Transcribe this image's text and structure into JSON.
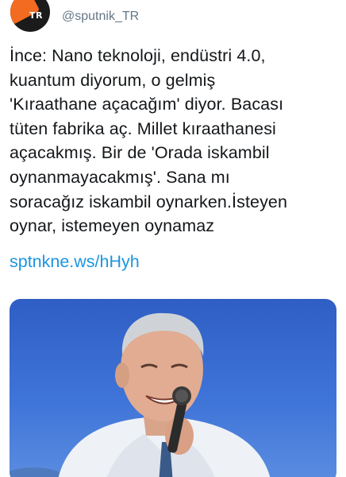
{
  "tweet": {
    "avatar_badge": "TR",
    "handle": "@sputnik_TR",
    "text_lines": [
      "İnce: Nano teknoloji, endüstri 4.0,",
      "kuantum diyorum, o gelmiş",
      "'Kıraathane açacağım' diyor. Bacası",
      "tüten fabrika aç. Millet kıraathanesi",
      "açacakmış. Bir de 'Orada iskambil",
      "oynanmayacakmış'. Sana mı",
      "soracağız iskambil oynarken.İsteyen",
      "oynar, istemeyen oynamaz"
    ],
    "link": "sptnkne.ws/hHyh",
    "media_icon": "photo-of-speaker-with-microphone"
  },
  "colors": {
    "link": "#1b95e0",
    "handle": "#657786",
    "text": "#14171a",
    "brand_orange": "#f26b21"
  }
}
